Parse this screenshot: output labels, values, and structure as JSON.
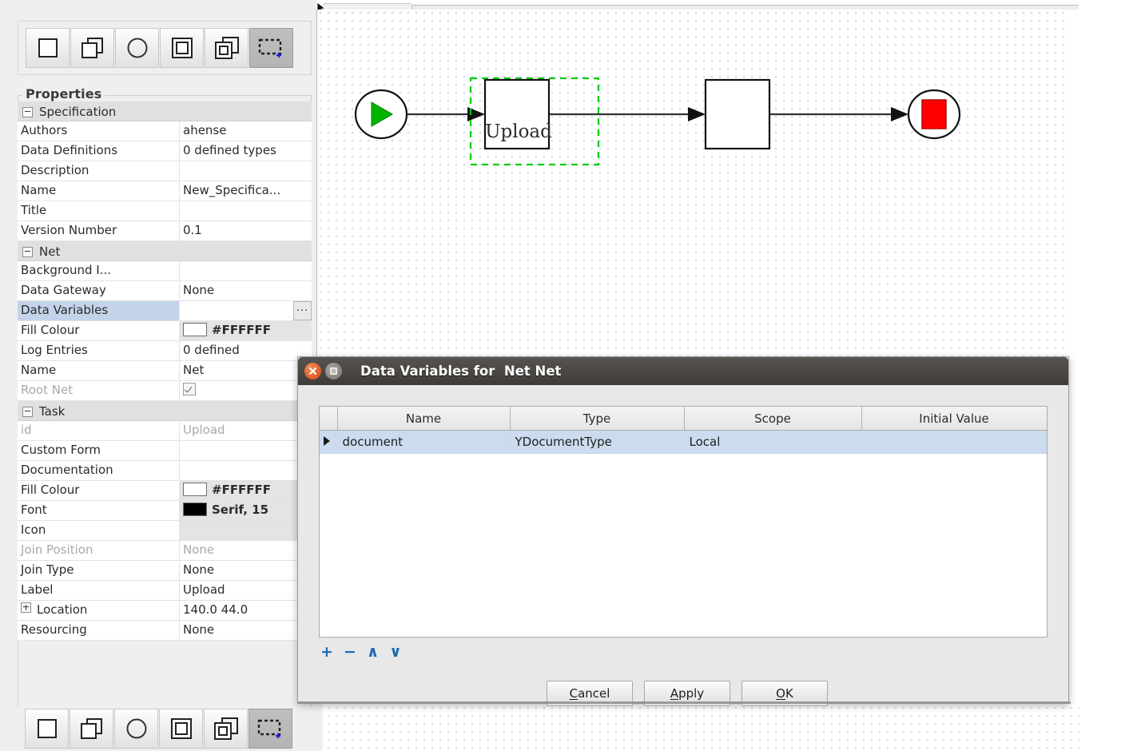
{
  "palette": {
    "buttons": [
      {
        "name": "atomic-task-tool",
        "icon": "square-icon"
      },
      {
        "name": "multiple-atomic-task-tool",
        "icon": "stacked-squares-icon"
      },
      {
        "name": "condition-tool",
        "icon": "circle-icon"
      },
      {
        "name": "composite-task-tool",
        "icon": "nested-square-icon"
      },
      {
        "name": "multiple-composite-task-tool",
        "icon": "stacked-nested-squares-icon"
      },
      {
        "name": "marquee-select-tool",
        "icon": "dashed-rect-plus-icon",
        "pressed": true
      }
    ]
  },
  "properties": {
    "legend": "Properties",
    "rows": [
      {
        "type": "group",
        "key": "Specification",
        "value": "",
        "expanded": true
      },
      {
        "type": "row",
        "key": "Authors",
        "value": "ahense"
      },
      {
        "type": "row",
        "key": "Data Definitions",
        "value": "0 defined types"
      },
      {
        "type": "row",
        "key": "Description",
        "value": ""
      },
      {
        "type": "row",
        "key": "Name",
        "value": "New_Specifica..."
      },
      {
        "type": "row",
        "key": "Title",
        "value": ""
      },
      {
        "type": "row",
        "key": "Version Number",
        "value": "0.1"
      },
      {
        "type": "group",
        "key": "Net",
        "value": "",
        "expanded": true
      },
      {
        "type": "row",
        "key": "Background I...",
        "value": ""
      },
      {
        "type": "row",
        "key": "Data Gateway",
        "value": "None"
      },
      {
        "type": "row",
        "key": "Data Variables",
        "value": "",
        "selected": true,
        "ellipsis": "...",
        "ellipsis_name": "data-variables-ellipsis-button"
      },
      {
        "type": "row",
        "key": "Fill Colour",
        "value": "#FFFFFF",
        "swatch": "white",
        "shaded": true
      },
      {
        "type": "row",
        "key": "Log Entries",
        "value": "0 defined"
      },
      {
        "type": "row",
        "key": "Name",
        "value": "Net"
      },
      {
        "type": "row",
        "key": "Root Net",
        "value": "",
        "checkbox": true,
        "disabled": true
      },
      {
        "type": "group",
        "key": "Task",
        "value": "",
        "expanded": true
      },
      {
        "type": "row",
        "key": "id",
        "value": "Upload",
        "disabled": true
      },
      {
        "type": "row",
        "key": "Custom Form",
        "value": ""
      },
      {
        "type": "row",
        "key": "Documentation",
        "value": ""
      },
      {
        "type": "row",
        "key": "Fill Colour",
        "value": "#FFFFFF",
        "swatch": "white",
        "shaded": true
      },
      {
        "type": "row",
        "key": "Font",
        "value": "Serif, 15",
        "swatch": "black",
        "shaded": true
      },
      {
        "type": "row",
        "key": "Icon",
        "value": "",
        "shaded": true
      },
      {
        "type": "row",
        "key": "Join Position",
        "value": "None",
        "disabled": true
      },
      {
        "type": "row",
        "key": "Join Type",
        "value": "None"
      },
      {
        "type": "row",
        "key": "Label",
        "value": "Upload"
      },
      {
        "type": "row",
        "key": "Location",
        "value": "140.0 44.0",
        "expander": "plus"
      },
      {
        "type": "row",
        "key": "Resourcing",
        "value": "None"
      }
    ]
  },
  "diagram": {
    "input_condition": {
      "name": "input-condition",
      "shape": "circle-with-green-play"
    },
    "output_condition": {
      "name": "output-condition",
      "shape": "circle-with-red-square"
    },
    "selected_task": {
      "label": "Upload",
      "selected": true
    },
    "second_task": {
      "label": ""
    },
    "selection_color": "#00cc00"
  },
  "dialog": {
    "title": "Data Variables for  Net Net",
    "window_buttons": {
      "close": "close-icon",
      "maximize": "maximize-icon"
    },
    "table": {
      "columns": [
        "",
        "Name",
        "Type",
        "Scope",
        "Initial Value"
      ],
      "rows": [
        {
          "marker": true,
          "selected": true,
          "cells": [
            "",
            "document",
            "YDocumentType",
            "Local",
            ""
          ]
        }
      ]
    },
    "mini_tools": [
      {
        "name": "add-variable-button",
        "glyph": "+"
      },
      {
        "name": "remove-variable-button",
        "glyph": "−"
      },
      {
        "name": "move-up-button",
        "glyph": "∧"
      },
      {
        "name": "move-down-button",
        "glyph": "∨"
      }
    ],
    "buttons": [
      {
        "name": "cancel-button",
        "label": "Cancel",
        "mnemonic": "C"
      },
      {
        "name": "apply-button",
        "label": "Apply",
        "mnemonic": "A"
      },
      {
        "name": "ok-button",
        "label": "OK",
        "mnemonic": "O"
      }
    ]
  },
  "colors": {
    "selection_blue": "#ccdcee",
    "dialog_title_bg": "#4a4641",
    "close_button": "#e2622a",
    "link_blue": "#1c6bb0",
    "start_green": "#00b400",
    "end_red": "#ff0000"
  }
}
